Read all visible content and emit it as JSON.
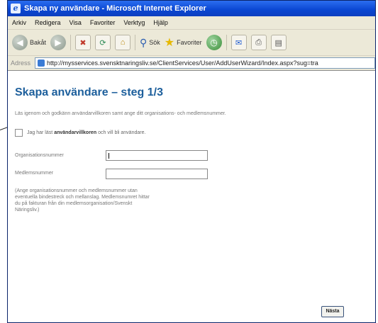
{
  "window": {
    "title": "Skapa ny användare - Microsoft Internet Explorer"
  },
  "menubar": {
    "items": [
      "Arkiv",
      "Redigera",
      "Visa",
      "Favoriter",
      "Verktyg",
      "Hjälp"
    ]
  },
  "toolbar": {
    "back": "Bakåt",
    "search": "Sök",
    "favorites": "Favoriter"
  },
  "address": {
    "label": "Adress",
    "url": "http://mysservices.svensktnaringsliv.se/ClientServices/User/AddUserWizard/Index.aspx?sug=tra"
  },
  "page": {
    "title": "Skapa användare – steg 1/3",
    "intro": "Läs igenom och godkänn användarvillkoren samt ange ditt organisations- och medlemsnummer.",
    "checkbox_prefix": "Jag har läst",
    "checkbox_link": "användarvillkoren",
    "checkbox_suffix": "och vill bli användare.",
    "org_label": "Organisationsnummer",
    "member_label": "Medlemsnummer",
    "help_lines": [
      "(Ange organisationsnummer och medlemsnummer utan",
      "eventuella bindestreck och mellanslag. Medlemsnumret hittar",
      "du på fakturan från din medlemsorganisation/Svenskt",
      "Näringsliv.)"
    ],
    "next_button": "Nästa"
  }
}
